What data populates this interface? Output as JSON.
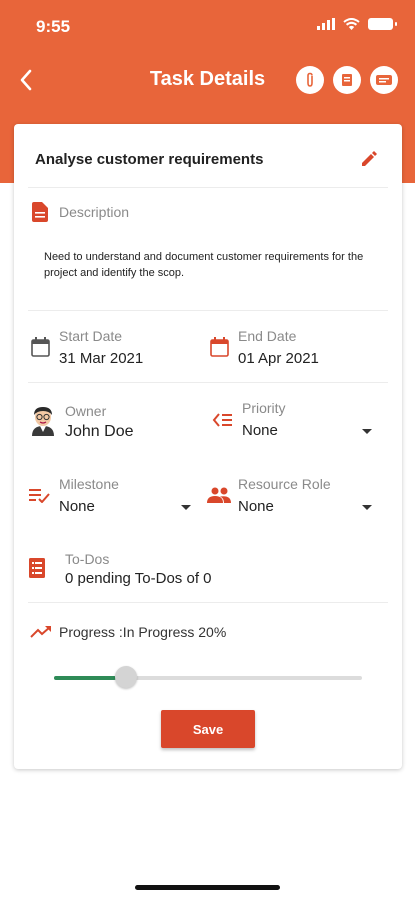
{
  "status": {
    "time": "9:55"
  },
  "appbar": {
    "title": "Task Details"
  },
  "task": {
    "name": "Analyse customer requirements",
    "description_label": "Description",
    "description_text": "Need to understand and document customer requirements for the project and identify the scop.",
    "start_date_label": "Start Date",
    "start_date": "31 Mar 2021",
    "end_date_label": "End Date",
    "end_date": "01 Apr 2021",
    "owner_label": "Owner",
    "owner": "John Doe",
    "priority_label": "Priority",
    "priority": "None",
    "milestone_label": "Milestone",
    "milestone": "None",
    "resource_role_label": "Resource Role",
    "resource_role": "None",
    "todos_label": "To-Dos",
    "todos": "0 pending To-Dos of 0",
    "progress_text": "Progress :In Progress 20%",
    "progress_value": 0.2,
    "save_label": "Save"
  },
  "colors": {
    "accent": "#e8653a",
    "icon_red": "#d9472b",
    "progress_green": "#2e8b57"
  },
  "icons": [
    "back-arrow-icon",
    "attachment-icon",
    "document-icon",
    "chat-icon",
    "edit-pencil-icon",
    "file-icon",
    "calendar-icon",
    "priority-icon",
    "milestone-icon",
    "people-icon",
    "todo-list-icon",
    "trend-up-icon"
  ]
}
